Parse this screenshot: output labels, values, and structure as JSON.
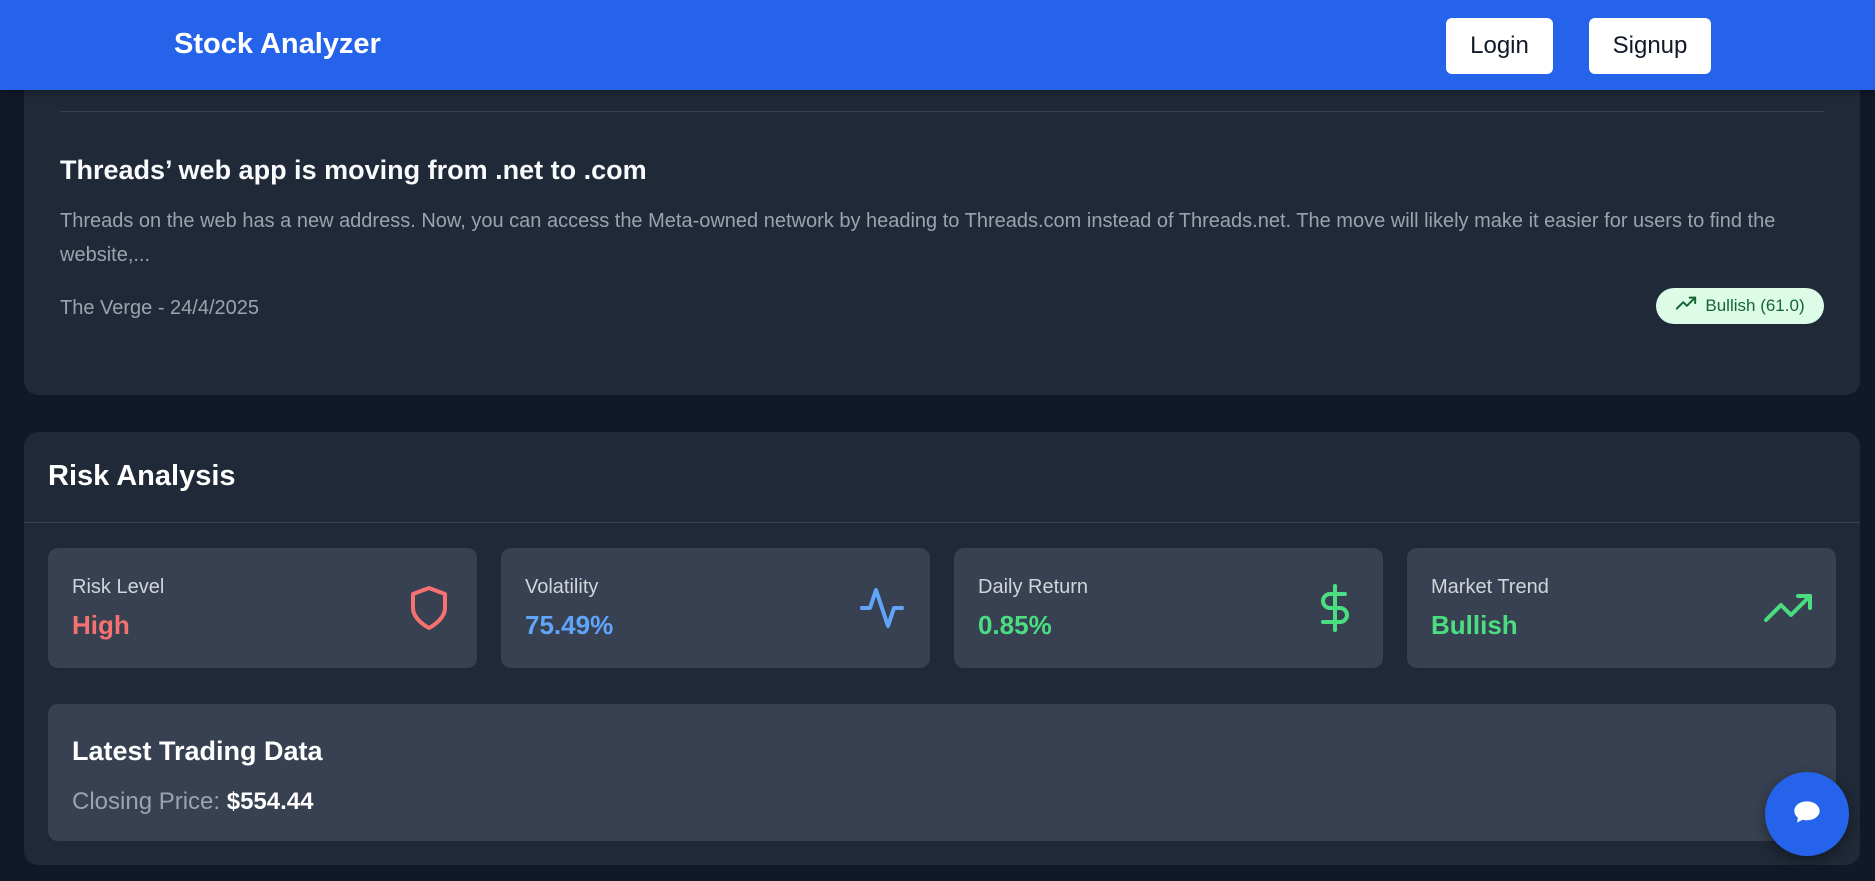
{
  "header": {
    "brand": "Stock Analyzer",
    "login_label": "Login",
    "signup_label": "Signup"
  },
  "news": {
    "title": "Threads’ web app is moving from .net to .com",
    "summary": "Threads on the web has a new address. Now, you can access the Meta-owned network by heading to Threads.com instead of Threads.net. The move will likely make it easier for users to find the website,...",
    "meta": "The Verge - 24/4/2025",
    "sentiment": "Bullish (61.0)",
    "sentiment_icon": "trending-up-icon"
  },
  "risk": {
    "title": "Risk Analysis",
    "metrics": [
      {
        "label": "Risk Level",
        "value": "High",
        "color": "#f87171",
        "icon": "shield-icon"
      },
      {
        "label": "Volatility",
        "value": "75.49%",
        "color": "#60a5fa",
        "icon": "activity-icon"
      },
      {
        "label": "Daily Return",
        "value": "0.85%",
        "color": "#4ade80",
        "icon": "dollar-sign-icon"
      },
      {
        "label": "Market Trend",
        "value": "Bullish",
        "color": "#4ade80",
        "icon": "trending-up-icon"
      }
    ]
  },
  "trading": {
    "title": "Latest Trading Data",
    "closing_label": "Closing Price:",
    "closing_price": "$554.44"
  },
  "chat": {
    "icon": "chat-bubble-icon"
  },
  "colors": {
    "navbar": "#2563eb",
    "page_bg": "#111827",
    "card_bg": "#1f2937",
    "tile_bg": "#374151"
  }
}
